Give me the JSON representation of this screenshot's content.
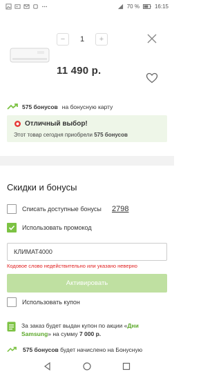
{
  "status_bar": {
    "battery": "70 %",
    "time": "16:15"
  },
  "product": {
    "quantity": "1",
    "minus_label": "−",
    "plus_label": "+",
    "price": "11 490 р."
  },
  "bonus_card": {
    "amount": "575 бонусов",
    "suffix": "на бонусную карту"
  },
  "good_choice": {
    "title": "Отличный выбор!",
    "subtitle_prefix": "Этот товар сегодня приобрели",
    "subtitle_count": "575 бонусов"
  },
  "discounts": {
    "title": "Скидки и бонусы",
    "spend_bonuses_label": "Списать доступные бонусы",
    "available_bonuses": "2798",
    "use_promo_label": "Использовать промокод",
    "promo_value": "КЛИМАТ4000",
    "error_message": "Кодовое слово недействительно или указано неверно",
    "activate_label": "Активировать",
    "use_coupon_label": "Использовать купон"
  },
  "coupon_info": {
    "prefix": "За заказ будет выдан купон по акции «",
    "link": "Дни Samsung",
    "middle": "» на сумму ",
    "amount": "7 000 р."
  },
  "bonus_info": {
    "amount": "575 бонусов",
    "suffix": "будет начислено на Бонусную"
  },
  "colors": {
    "accent": "#7cc243",
    "error": "#e02020",
    "choice_bg": "#eef6e8"
  },
  "icons": [
    "close-icon",
    "heart-icon",
    "bonus-arrow-icon",
    "badge-icon",
    "coupon-icon",
    "back-icon",
    "home-icon",
    "recent-icon"
  ]
}
